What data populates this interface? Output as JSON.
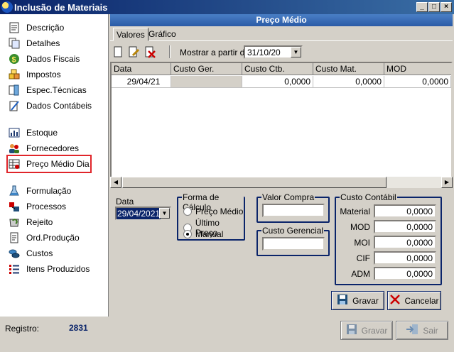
{
  "window": {
    "title": "Inclusão de Materiais"
  },
  "sidebar": {
    "items": [
      {
        "label": "Descrição",
        "icon": "document-icon"
      },
      {
        "label": "Detalhes",
        "icon": "details-icon"
      },
      {
        "label": "Dados Fiscais",
        "icon": "dollar-icon"
      },
      {
        "label": "Impostos",
        "icon": "boxes-icon"
      },
      {
        "label": "Espec.Técnicas",
        "icon": "technical-spec-icon"
      },
      {
        "label": "Dados Contábeis",
        "icon": "accounting-icon"
      },
      {
        "label": "Estoque",
        "icon": "bar-chart-icon"
      },
      {
        "label": "Fornecedores",
        "icon": "people-icon"
      },
      {
        "label": "Preço Médio Dia",
        "icon": "price-table-icon",
        "selected": true
      },
      {
        "label": "Formulação",
        "icon": "flask-icon"
      },
      {
        "label": "Processos",
        "icon": "process-icon"
      },
      {
        "label": "Rejeito",
        "icon": "recycle-icon"
      },
      {
        "label": "Ord.Produção",
        "icon": "order-icon"
      },
      {
        "label": "Custos",
        "icon": "coins-icon"
      },
      {
        "label": "Itens Produzidos",
        "icon": "list-icon"
      }
    ]
  },
  "pane": {
    "title": "Preço Médio",
    "tabs": [
      {
        "label": "Valores",
        "active": true
      },
      {
        "label": "Gráfico",
        "active": false
      }
    ],
    "toolbar": {
      "mostrar_label": "Mostrar a partir de:",
      "mostrar_value": "31/10/20"
    },
    "grid": {
      "columns": [
        "Data",
        "Custo Ger.",
        "Custo Ctb.",
        "Custo Mat.",
        "MOD"
      ],
      "rows": [
        [
          "29/04/21",
          "",
          "0,0000",
          "0,0000",
          "0,0000"
        ]
      ]
    }
  },
  "form": {
    "data_label": "Data",
    "data_value": "29/04/2021",
    "forma_title": "Forma de Cálculo",
    "forma_options": [
      {
        "label": "Preço Médio",
        "checked": false
      },
      {
        "label": "Último Preço",
        "checked": false
      },
      {
        "label": "Manual",
        "checked": true
      }
    ],
    "valor_compra_title": "Valor Compra",
    "valor_compra_value": "",
    "custo_gerencial_title": "Custo Gerencial",
    "custo_gerencial_value": "",
    "custo_contabil_title": "Custo Contábil",
    "custo_contabil_fields": [
      {
        "label": "Material",
        "value": "0,0000"
      },
      {
        "label": "MOD",
        "value": "0,0000"
      },
      {
        "label": "MOI",
        "value": "0,0000"
      },
      {
        "label": "CIF",
        "value": "0,0000"
      },
      {
        "label": "ADM",
        "value": "0,0000"
      }
    ],
    "gravar_label": "Gravar",
    "cancelar_label": "Cancelar"
  },
  "footer": {
    "registro_label": "Registro:",
    "registro_value": "2831",
    "gravar_label": "Gravar",
    "sair_label": "Sair"
  },
  "colors": {
    "accent": "#0a246a",
    "highlight": "#e0252a"
  }
}
